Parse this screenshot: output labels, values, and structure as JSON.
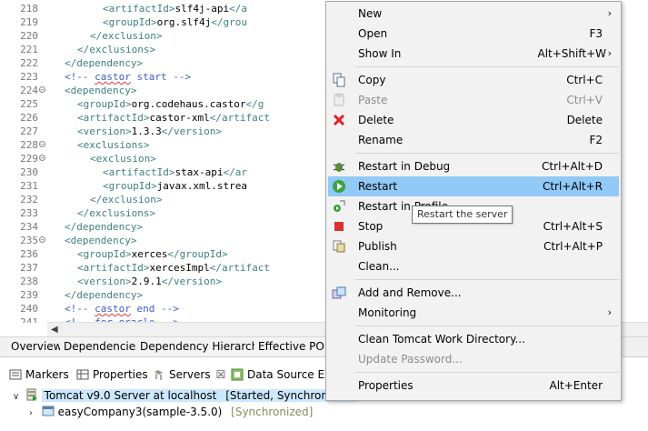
{
  "editor": {
    "lines": [
      {
        "num": "218",
        "fold": "",
        "indent": 7,
        "parts": [
          [
            "tag",
            "<artifactId>"
          ],
          [
            "txt",
            "slf4j-api"
          ],
          [
            "tag",
            "</a"
          ]
        ]
      },
      {
        "num": "219",
        "fold": "",
        "indent": 7,
        "parts": [
          [
            "tag",
            "<groupId>"
          ],
          [
            "txt",
            "org.slf4j"
          ],
          [
            "tag",
            "</grou"
          ]
        ]
      },
      {
        "num": "220",
        "fold": "",
        "indent": 6,
        "parts": [
          [
            "tag",
            "</exclusion>"
          ]
        ]
      },
      {
        "num": "221",
        "fold": "",
        "indent": 5,
        "parts": [
          [
            "tag",
            "</exclusions>"
          ]
        ]
      },
      {
        "num": "222",
        "fold": "",
        "indent": 4,
        "parts": [
          [
            "tag",
            "</dependency>"
          ]
        ]
      },
      {
        "num": "223",
        "fold": "",
        "indent": 4,
        "parts": [
          [
            "cmt",
            "<!-- "
          ],
          [
            "cmtsq",
            "castor"
          ],
          [
            "cmt",
            " start -->"
          ]
        ]
      },
      {
        "num": "224",
        "fold": "⊖",
        "indent": 4,
        "parts": [
          [
            "tag",
            "<dependency>"
          ]
        ]
      },
      {
        "num": "225",
        "fold": "",
        "indent": 5,
        "parts": [
          [
            "tag",
            "<groupId>"
          ],
          [
            "txt",
            "org.codehaus.castor"
          ],
          [
            "tag",
            "</g"
          ]
        ]
      },
      {
        "num": "226",
        "fold": "",
        "indent": 5,
        "parts": [
          [
            "tag",
            "<artifactId>"
          ],
          [
            "txt",
            "castor-xml"
          ],
          [
            "tag",
            "</artifact"
          ]
        ]
      },
      {
        "num": "227",
        "fold": "",
        "indent": 5,
        "parts": [
          [
            "tag",
            "<version>"
          ],
          [
            "txt",
            "1.3.3"
          ],
          [
            "tag",
            "</version>"
          ]
        ]
      },
      {
        "num": "228",
        "fold": "⊖",
        "indent": 5,
        "parts": [
          [
            "tag",
            "<exclusions>"
          ]
        ]
      },
      {
        "num": "229",
        "fold": "⊖",
        "indent": 6,
        "parts": [
          [
            "tag",
            "<exclusion>"
          ]
        ]
      },
      {
        "num": "230",
        "fold": "",
        "indent": 7,
        "parts": [
          [
            "tag",
            "<artifactId>"
          ],
          [
            "txt",
            "stax-api"
          ],
          [
            "tag",
            "</ar"
          ]
        ]
      },
      {
        "num": "231",
        "fold": "",
        "indent": 7,
        "parts": [
          [
            "tag",
            "<groupId>"
          ],
          [
            "txt",
            "javax.xml.strea"
          ]
        ]
      },
      {
        "num": "232",
        "fold": "",
        "indent": 6,
        "parts": [
          [
            "tag",
            "</exclusion>"
          ]
        ]
      },
      {
        "num": "233",
        "fold": "",
        "indent": 5,
        "parts": [
          [
            "tag",
            "</exclusions>"
          ]
        ]
      },
      {
        "num": "234",
        "fold": "",
        "indent": 4,
        "parts": [
          [
            "tag",
            "</dependency>"
          ]
        ]
      },
      {
        "num": "235",
        "fold": "⊖",
        "indent": 4,
        "parts": [
          [
            "tag",
            "<dependency>"
          ]
        ]
      },
      {
        "num": "236",
        "fold": "",
        "indent": 5,
        "parts": [
          [
            "tag",
            "<groupId>"
          ],
          [
            "txt",
            "xerces"
          ],
          [
            "tag",
            "</groupId>"
          ]
        ]
      },
      {
        "num": "237",
        "fold": "",
        "indent": 5,
        "parts": [
          [
            "tag",
            "<artifactId>"
          ],
          [
            "txt",
            "xercesImpl"
          ],
          [
            "tag",
            "</artifact"
          ]
        ]
      },
      {
        "num": "238",
        "fold": "",
        "indent": 5,
        "parts": [
          [
            "tag",
            "<version>"
          ],
          [
            "txt",
            "2.9.1"
          ],
          [
            "tag",
            "</version>"
          ]
        ]
      },
      {
        "num": "239",
        "fold": "",
        "indent": 4,
        "parts": [
          [
            "tag",
            "</dependency>"
          ]
        ]
      },
      {
        "num": "240",
        "fold": "",
        "indent": 4,
        "parts": [
          [
            "cmt",
            "<!-- "
          ],
          [
            "cmtsq",
            "castor"
          ],
          [
            "cmt",
            " end -->"
          ]
        ]
      },
      {
        "num": "241",
        "fold": "",
        "indent": 4,
        "parts": [
          [
            "cmt",
            "<!-- for oracle -->"
          ]
        ]
      }
    ]
  },
  "pom_tabs": [
    "Overview",
    "Dependencies",
    "Dependency Hierarchy",
    "Effective POM"
  ],
  "views": {
    "tabs": [
      {
        "label": "Markers",
        "icon": "markers-icon"
      },
      {
        "label": "Properties",
        "icon": "properties-icon"
      },
      {
        "label": "Servers",
        "icon": "servers-icon",
        "active": true,
        "close": "☒"
      },
      {
        "label": "Data Source Exp",
        "icon": "data-source-icon"
      }
    ],
    "server_name": "Tomcat v9.0 Server at localhost",
    "server_state": "[Started, Synchronized]",
    "module_name": "easyCompany3(sample-3.5.0)",
    "module_state": "[Synchronized]"
  },
  "context_menu": {
    "items": [
      {
        "label": "New",
        "shortcut": "",
        "submenu": true,
        "icon": ""
      },
      {
        "label": "Open",
        "shortcut": "F3",
        "icon": ""
      },
      {
        "label": "Show In",
        "shortcut": "Alt+Shift+W",
        "submenu": true,
        "icon": ""
      },
      {
        "sep": true
      },
      {
        "label": "Copy",
        "shortcut": "Ctrl+C",
        "icon": "copy-icon"
      },
      {
        "label": "Paste",
        "shortcut": "Ctrl+V",
        "icon": "paste-icon",
        "disabled": true
      },
      {
        "label": "Delete",
        "shortcut": "Delete",
        "icon": "delete-icon"
      },
      {
        "label": "Rename",
        "shortcut": "F2",
        "icon": ""
      },
      {
        "sep": true
      },
      {
        "label": "Restart in Debug",
        "shortcut": "Ctrl+Alt+D",
        "icon": "debug-icon"
      },
      {
        "label": "Restart",
        "shortcut": "Ctrl+Alt+R",
        "icon": "restart-icon",
        "highlight": true
      },
      {
        "label": "Restart in Profile",
        "shortcut": "",
        "icon": "profile-icon"
      },
      {
        "label": "Stop",
        "shortcut": "Ctrl+Alt+S",
        "icon": "stop-icon"
      },
      {
        "label": "Publish",
        "shortcut": "Ctrl+Alt+P",
        "icon": "publish-icon"
      },
      {
        "label": "Clean...",
        "shortcut": "",
        "icon": ""
      },
      {
        "sep": true
      },
      {
        "label": "Add and Remove...",
        "shortcut": "",
        "icon": "add-remove-icon"
      },
      {
        "label": "Monitoring",
        "shortcut": "",
        "submenu": true,
        "icon": ""
      },
      {
        "sep": true
      },
      {
        "label": "Clean Tomcat Work Directory...",
        "shortcut": "",
        "icon": ""
      },
      {
        "label": "Update Password...",
        "shortcut": "",
        "icon": "",
        "disabled": true
      },
      {
        "sep": true
      },
      {
        "label": "Properties",
        "shortcut": "Alt+Enter",
        "icon": ""
      }
    ]
  },
  "tooltip": "Restart the server",
  "colors": {
    "highlight": "#91c9f7",
    "selection": "#cce8ff",
    "tag": "#3f7f7f",
    "comment": "#3f5fbf"
  }
}
